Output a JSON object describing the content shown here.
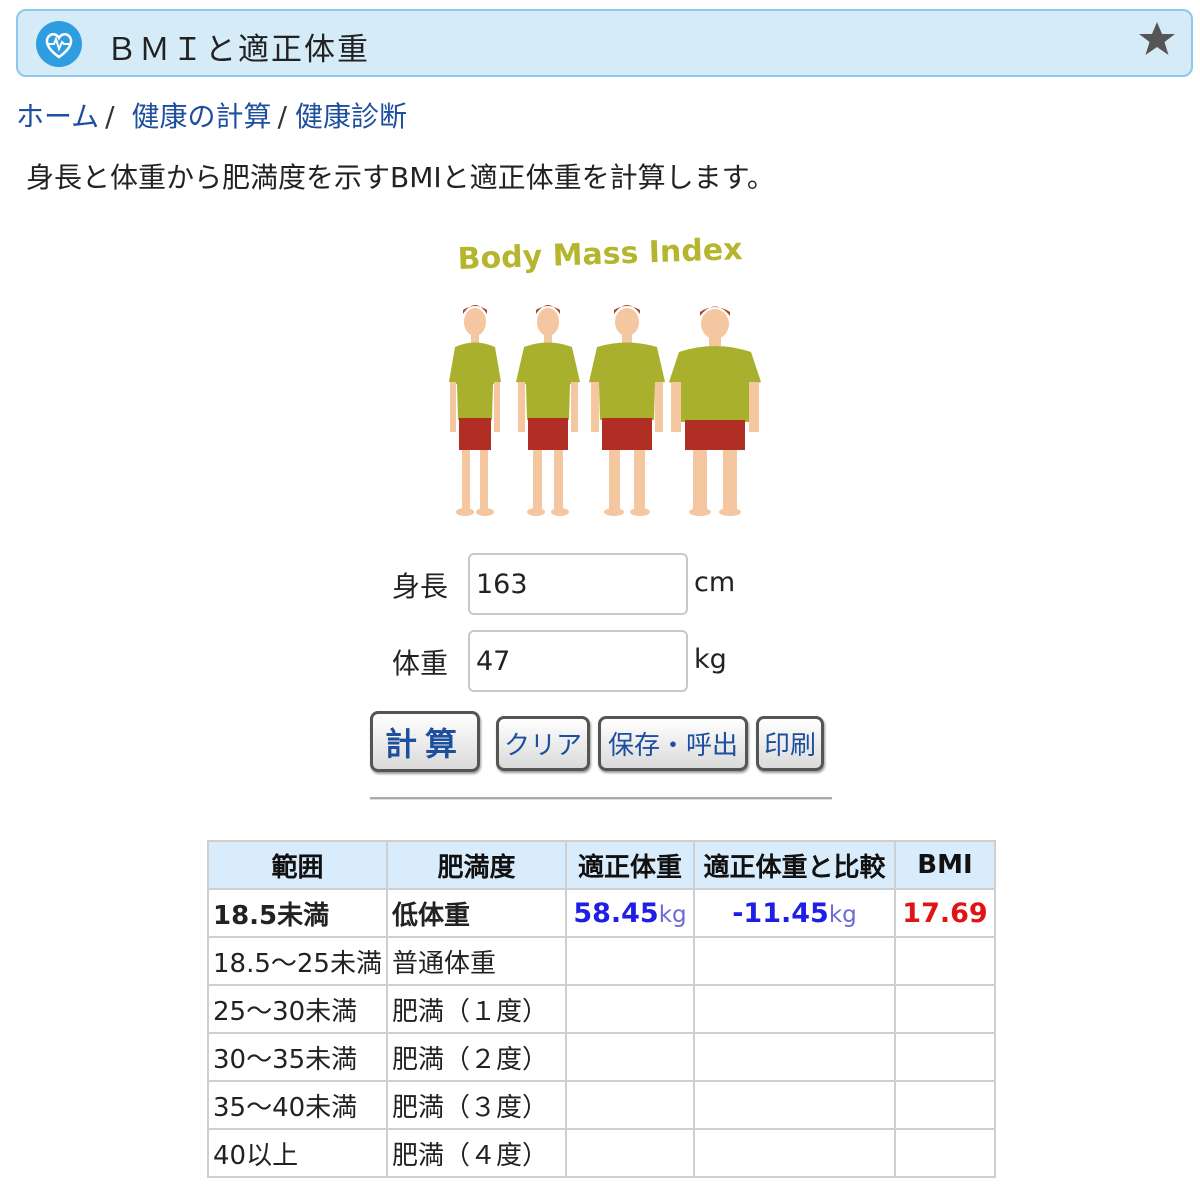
{
  "header": {
    "title": "ＢＭＩと適正体重",
    "icon": "heart-pulse-icon",
    "star_icon": "star-icon",
    "accent_color": "#d5ebf8"
  },
  "breadcrumb": {
    "items": [
      "ホーム",
      "健康の計算",
      "健康診断"
    ],
    "separator": "/"
  },
  "description": "身長と体重から肥満度を示すBMIと適正体重を計算します。",
  "illustration": {
    "caption": "Body Mass Index"
  },
  "form": {
    "height": {
      "label": "身長",
      "value": "163",
      "unit": "cm"
    },
    "weight": {
      "label": "体重",
      "value": "47",
      "unit": "kg"
    }
  },
  "buttons": {
    "calculate": "計算",
    "clear": "クリア",
    "save_load": "保存・呼出",
    "print": "印刷"
  },
  "table": {
    "headers": [
      "範囲",
      "肥満度",
      "適正体重",
      "適正体重と比較",
      "BMI"
    ],
    "rows": [
      {
        "range": "18.5未満",
        "category": "低体重",
        "ideal": "58.45",
        "ideal_unit": "kg",
        "diff": "-11.45",
        "diff_unit": "kg",
        "bmi": "17.69",
        "highlight": true
      },
      {
        "range": "18.5～25未満",
        "category": "普通体重"
      },
      {
        "range": "25～30未満",
        "category": "肥満（１度）"
      },
      {
        "range": "30～35未満",
        "category": "肥満（２度）"
      },
      {
        "range": "35～40未満",
        "category": "肥満（３度）"
      },
      {
        "range": "40以上",
        "category": "肥満（４度）"
      }
    ],
    "colors": {
      "highlight_text": "#f06a6a",
      "value_blue": "#1e1ee6",
      "bmi_red": "#e01414",
      "header_bg": "#d9ecfb"
    }
  }
}
